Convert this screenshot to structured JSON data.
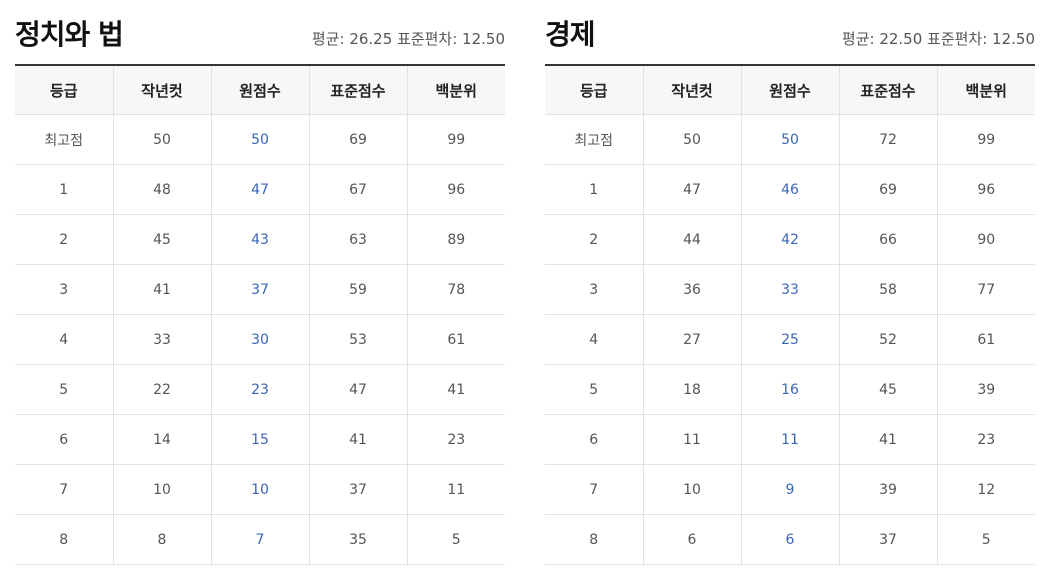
{
  "colors": {
    "raw_score": "#3b66b8",
    "header_bg": "#f7f7f7",
    "border": "#e2e2e2",
    "top_rule": "#333333"
  },
  "columns": [
    "등급",
    "작년컷",
    "원점수",
    "표준점수",
    "백분위"
  ],
  "subjects": [
    {
      "title": "정치와 법",
      "stats": "평균: 26.25 표준편차: 12.50",
      "rows": [
        {
          "grade": "최고점",
          "last_year_cut": "50",
          "raw": "50",
          "standard": "69",
          "percentile": "99"
        },
        {
          "grade": "1",
          "last_year_cut": "48",
          "raw": "47",
          "standard": "67",
          "percentile": "96"
        },
        {
          "grade": "2",
          "last_year_cut": "45",
          "raw": "43",
          "standard": "63",
          "percentile": "89"
        },
        {
          "grade": "3",
          "last_year_cut": "41",
          "raw": "37",
          "standard": "59",
          "percentile": "78"
        },
        {
          "grade": "4",
          "last_year_cut": "33",
          "raw": "30",
          "standard": "53",
          "percentile": "61"
        },
        {
          "grade": "5",
          "last_year_cut": "22",
          "raw": "23",
          "standard": "47",
          "percentile": "41"
        },
        {
          "grade": "6",
          "last_year_cut": "14",
          "raw": "15",
          "standard": "41",
          "percentile": "23"
        },
        {
          "grade": "7",
          "last_year_cut": "10",
          "raw": "10",
          "standard": "37",
          "percentile": "11"
        },
        {
          "grade": "8",
          "last_year_cut": "8",
          "raw": "7",
          "standard": "35",
          "percentile": "5"
        }
      ]
    },
    {
      "title": "경제",
      "stats": "평균: 22.50 표준편차: 12.50",
      "rows": [
        {
          "grade": "최고점",
          "last_year_cut": "50",
          "raw": "50",
          "standard": "72",
          "percentile": "99"
        },
        {
          "grade": "1",
          "last_year_cut": "47",
          "raw": "46",
          "standard": "69",
          "percentile": "96"
        },
        {
          "grade": "2",
          "last_year_cut": "44",
          "raw": "42",
          "standard": "66",
          "percentile": "90"
        },
        {
          "grade": "3",
          "last_year_cut": "36",
          "raw": "33",
          "standard": "58",
          "percentile": "77"
        },
        {
          "grade": "4",
          "last_year_cut": "27",
          "raw": "25",
          "standard": "52",
          "percentile": "61"
        },
        {
          "grade": "5",
          "last_year_cut": "18",
          "raw": "16",
          "standard": "45",
          "percentile": "39"
        },
        {
          "grade": "6",
          "last_year_cut": "11",
          "raw": "11",
          "standard": "41",
          "percentile": "23"
        },
        {
          "grade": "7",
          "last_year_cut": "10",
          "raw": "9",
          "standard": "39",
          "percentile": "12"
        },
        {
          "grade": "8",
          "last_year_cut": "6",
          "raw": "6",
          "standard": "37",
          "percentile": "5"
        }
      ]
    }
  ]
}
